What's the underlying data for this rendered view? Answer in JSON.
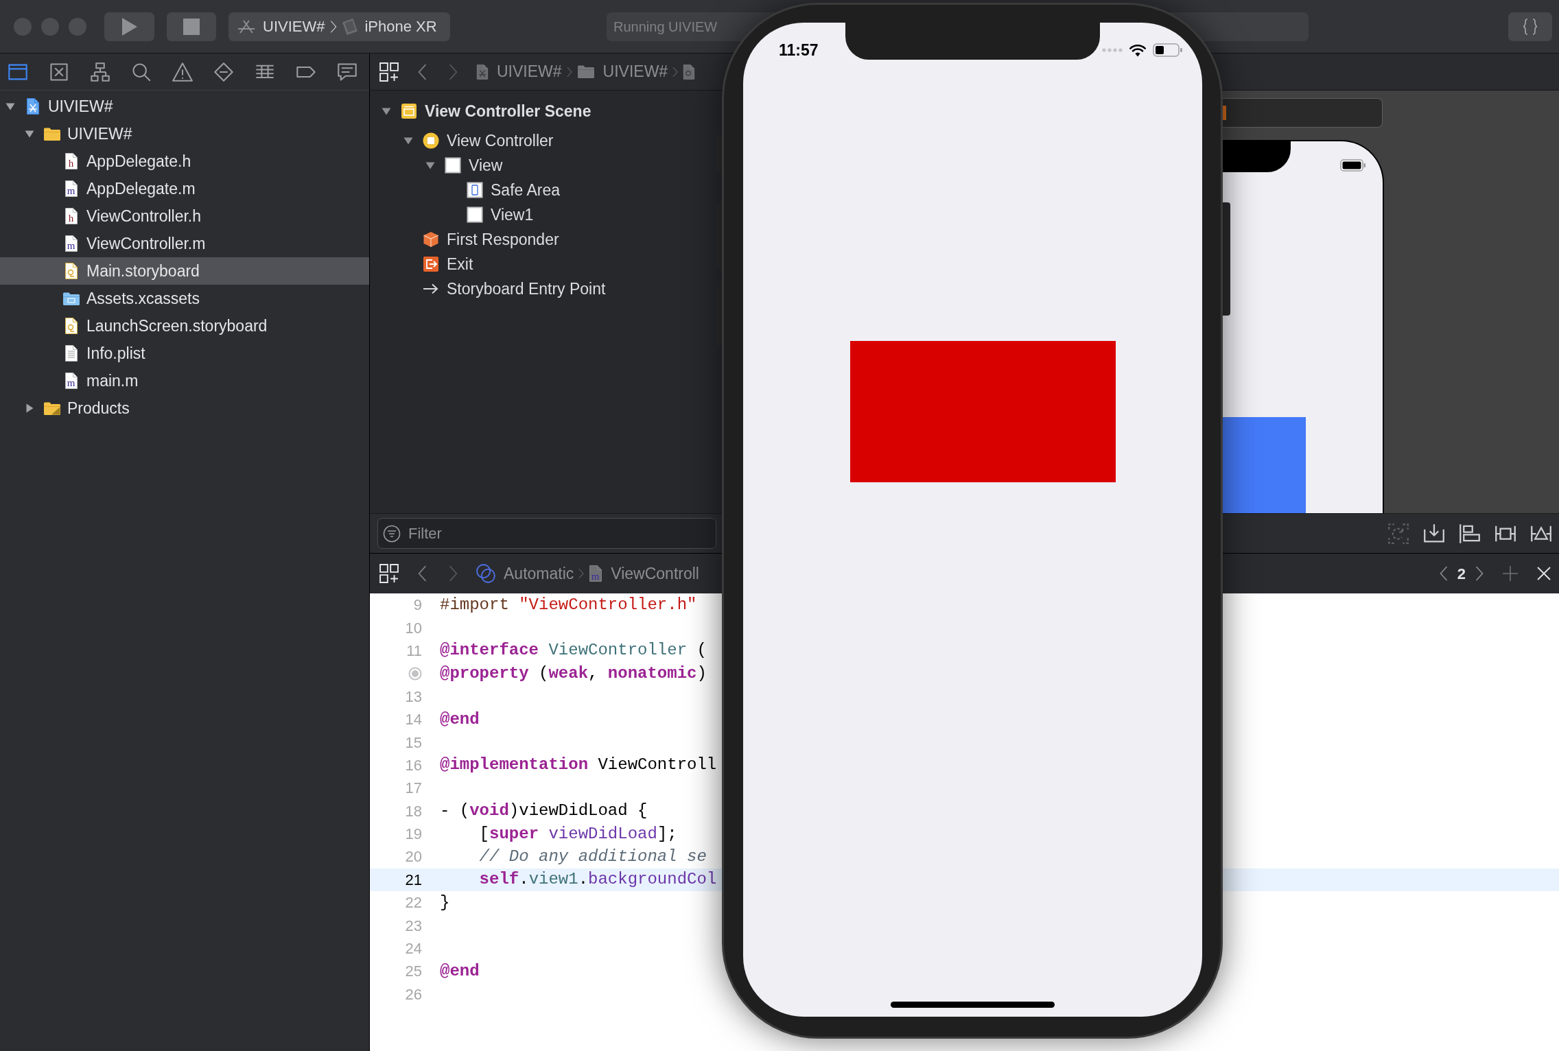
{
  "toolbar": {
    "scheme": {
      "project": "UIVIEW#",
      "device": "iPhone XR"
    },
    "activity": {
      "status": "Running UIVIEW"
    }
  },
  "navigator": {
    "tabs": [
      {
        "kind": "project",
        "selected": true
      },
      {
        "kind": "source-control",
        "selected": false
      },
      {
        "kind": "symbol",
        "selected": false
      },
      {
        "kind": "find",
        "selected": false
      },
      {
        "kind": "issue",
        "selected": false
      },
      {
        "kind": "test",
        "selected": false
      },
      {
        "kind": "debug",
        "selected": false
      },
      {
        "kind": "breakpoint",
        "selected": false
      },
      {
        "kind": "report",
        "selected": false
      }
    ],
    "tree": [
      {
        "label": "UIVIEW#",
        "kind": "project",
        "expanded": true,
        "selected": false,
        "children": [
          {
            "label": "UIVIEW#",
            "kind": "folder",
            "expanded": true,
            "selected": false,
            "children": [
              {
                "label": "AppDelegate.h",
                "kind": "header",
                "icon_letter": "h",
                "selected": false
              },
              {
                "label": "AppDelegate.m",
                "kind": "implementation",
                "icon_letter": "m",
                "selected": false
              },
              {
                "label": "ViewController.h",
                "kind": "header",
                "icon_letter": "h",
                "selected": false
              },
              {
                "label": "ViewController.m",
                "kind": "implementation",
                "icon_letter": "m",
                "selected": false
              },
              {
                "label": "Main.storyboard",
                "kind": "storyboard",
                "selected": true
              },
              {
                "label": "Assets.xcassets",
                "kind": "assets",
                "selected": false
              },
              {
                "label": "LaunchScreen.storyboard",
                "kind": "storyboard",
                "selected": false
              },
              {
                "label": "Info.plist",
                "kind": "plist",
                "selected": false
              },
              {
                "label": "main.m",
                "kind": "implementation",
                "icon_letter": "m",
                "selected": false
              }
            ]
          },
          {
            "label": "Products",
            "kind": "products",
            "expanded": false,
            "selected": false
          }
        ]
      }
    ]
  },
  "editor": {
    "jump_bar": {
      "path": [
        {
          "kind": "project",
          "label": "UIVIEW#"
        },
        {
          "kind": "folder",
          "label": "UIVIEW#"
        },
        {
          "kind": "storyboard"
        }
      ]
    },
    "outline": {
      "tree": [
        {
          "label": "View Controller Scene",
          "kind": "scene",
          "expanded": true,
          "selected": false,
          "children": [
            {
              "label": "View Controller",
              "kind": "view-controller",
              "expanded": true,
              "selected": false,
              "children": [
                {
                  "label": "View",
                  "kind": "view",
                  "expanded": true,
                  "selected": false,
                  "children": [
                    {
                      "label": "Safe Area",
                      "kind": "safe-area",
                      "selected": false
                    },
                    {
                      "label": "View1",
                      "kind": "view",
                      "selected": false
                    }
                  ]
                }
              ]
            },
            {
              "label": "First Responder",
              "kind": "first-responder",
              "selected": false
            },
            {
              "label": "Exit",
              "kind": "exit",
              "selected": false
            },
            {
              "label": "Storyboard Entry Point",
              "kind": "entry-point",
              "selected": false
            }
          ]
        }
      ]
    },
    "filter": {
      "placeholder": "Filter"
    },
    "canvas_tools": [
      {
        "kind": "update-frames",
        "disabled": true
      },
      {
        "kind": "embed",
        "disabled": false
      },
      {
        "kind": "align",
        "disabled": false
      },
      {
        "kind": "pin",
        "disabled": false
      },
      {
        "kind": "resolve",
        "disabled": false
      }
    ]
  },
  "code_editor": {
    "jump_bar": {
      "path": [
        {
          "kind": "automatic",
          "label": "Automatic"
        },
        {
          "kind": "implementation",
          "icon_letter": "m",
          "label": "ViewControll"
        }
      ],
      "counter": "2"
    },
    "lines": [
      {
        "kind": "code",
        "number": "9",
        "current": false,
        "tokens": [
          {
            "text": "#import ",
            "kind": "preprocessor"
          },
          {
            "text": "\"ViewController.h\"",
            "kind": "string"
          }
        ]
      },
      {
        "kind": "code",
        "number": "10",
        "current": false
      },
      {
        "kind": "code",
        "number": "11",
        "current": false,
        "tokens": [
          {
            "text": "@interface ",
            "kind": "keyword"
          },
          {
            "text": "ViewController",
            "kind": "type"
          },
          {
            "text": " (",
            "kind": "plain"
          }
        ]
      },
      {
        "kind": "outlet",
        "current": false,
        "tokens": [
          {
            "text": "@property ",
            "kind": "keyword"
          },
          {
            "text": "(",
            "kind": "plain"
          },
          {
            "text": "weak",
            "kind": "keyword"
          },
          {
            "text": ", ",
            "kind": "plain"
          },
          {
            "text": "nonatomic",
            "kind": "keyword"
          },
          {
            "text": ")",
            "kind": "plain"
          }
        ]
      },
      {
        "kind": "code",
        "number": "13",
        "current": false
      },
      {
        "kind": "code",
        "number": "14",
        "current": false,
        "tokens": [
          {
            "text": "@end",
            "kind": "keyword"
          }
        ]
      },
      {
        "kind": "code",
        "number": "15",
        "current": false
      },
      {
        "kind": "code",
        "number": "16",
        "current": false,
        "tokens": [
          {
            "text": "@implementation ",
            "kind": "keyword"
          },
          {
            "text": "ViewControll",
            "kind": "plain"
          }
        ]
      },
      {
        "kind": "code",
        "number": "17",
        "current": false
      },
      {
        "kind": "code",
        "number": "18",
        "current": false,
        "tokens": [
          {
            "text": "- (",
            "kind": "plain"
          },
          {
            "text": "void",
            "kind": "keyword"
          },
          {
            "text": ")viewDidLoad {",
            "kind": "plain"
          }
        ]
      },
      {
        "kind": "code",
        "number": "19",
        "current": false,
        "tokens": [
          {
            "text": "    [",
            "kind": "plain"
          },
          {
            "text": "super ",
            "kind": "keyword"
          },
          {
            "text": "viewDidLoad",
            "kind": "method"
          },
          {
            "text": "];",
            "kind": "plain"
          }
        ]
      },
      {
        "kind": "code",
        "number": "20",
        "current": false,
        "tokens": [
          {
            "text": "    // Do any additional se",
            "kind": "comment"
          }
        ]
      },
      {
        "kind": "code",
        "number": "21",
        "current": true,
        "tokens": [
          {
            "text": "    self",
            "kind": "keyword"
          },
          {
            "text": ".",
            "kind": "plain"
          },
          {
            "text": "view1",
            "kind": "property"
          },
          {
            "text": ".",
            "kind": "plain"
          },
          {
            "text": "backgroundCol",
            "kind": "method"
          }
        ]
      },
      {
        "kind": "code",
        "number": "22",
        "current": false,
        "tokens": [
          {
            "text": "}",
            "kind": "plain"
          }
        ]
      },
      {
        "kind": "code",
        "number": "23",
        "current": false
      },
      {
        "kind": "code",
        "number": "24",
        "current": false
      },
      {
        "kind": "code",
        "number": "25",
        "current": false,
        "tokens": [
          {
            "text": "@end",
            "kind": "keyword"
          }
        ]
      },
      {
        "kind": "code",
        "number": "26",
        "current": false
      }
    ]
  },
  "simulator": {
    "time": "11:57"
  }
}
